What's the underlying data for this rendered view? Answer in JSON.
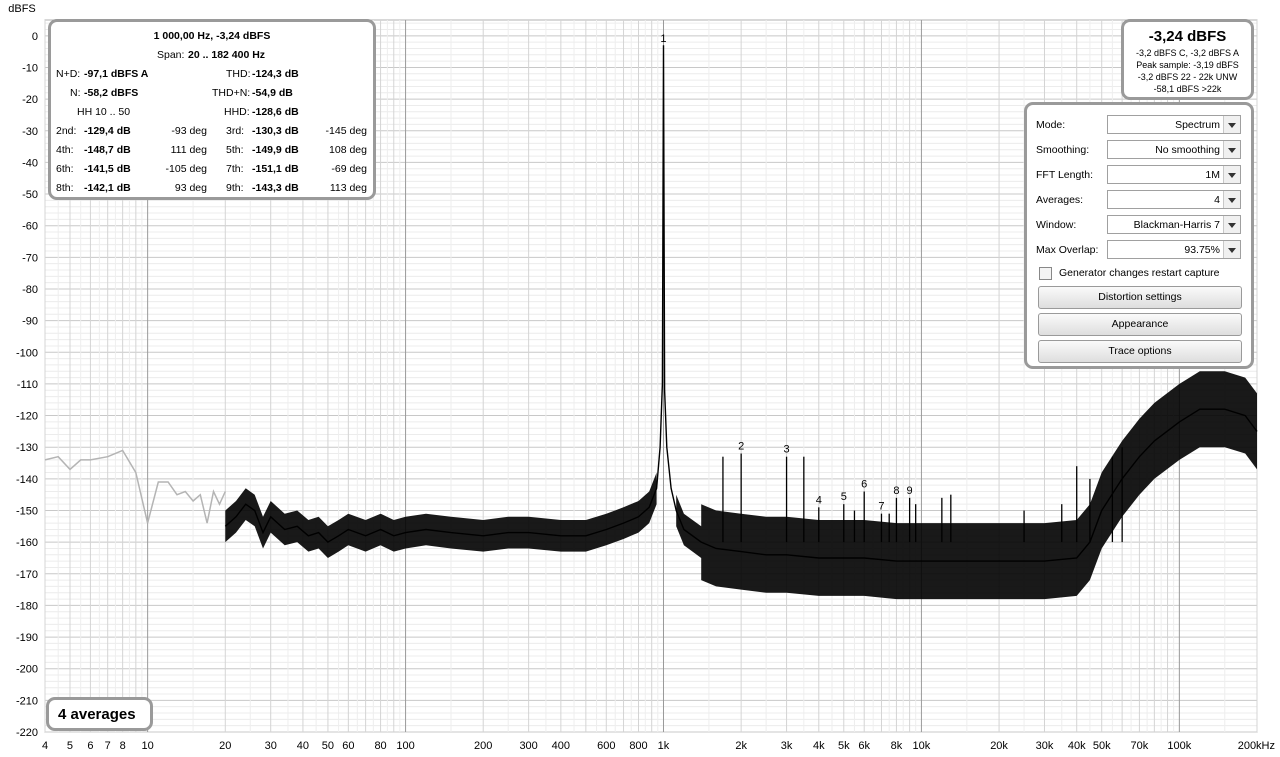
{
  "chart_data": {
    "type": "line",
    "ylabel": "dBFS",
    "xscale": "log",
    "xlim": [
      4,
      200000
    ],
    "ylim": [
      -220,
      5
    ],
    "y_ticks": [
      "0",
      "-10",
      "-20",
      "-30",
      "-40",
      "-50",
      "-60",
      "-70",
      "-80",
      "-90",
      "-100",
      "-110",
      "-120",
      "-130",
      "-140",
      "-150",
      "-160",
      "-170",
      "-180",
      "-190",
      "-200",
      "-210",
      "-220"
    ],
    "x_tick_labels": [
      {
        "f": 4,
        "t": "4"
      },
      {
        "f": 5,
        "t": "5"
      },
      {
        "f": 6,
        "t": "6"
      },
      {
        "f": 7,
        "t": "7"
      },
      {
        "f": 8,
        "t": "8"
      },
      {
        "f": 10,
        "t": "10"
      },
      {
        "f": 20,
        "t": "20"
      },
      {
        "f": 30,
        "t": "30"
      },
      {
        "f": 40,
        "t": "40"
      },
      {
        "f": 50,
        "t": "50"
      },
      {
        "f": 60,
        "t": "60"
      },
      {
        "f": 80,
        "t": "80"
      },
      {
        "f": 100,
        "t": "100"
      },
      {
        "f": 200,
        "t": "200"
      },
      {
        "f": 300,
        "t": "300"
      },
      {
        "f": 400,
        "t": "400"
      },
      {
        "f": 600,
        "t": "600"
      },
      {
        "f": 800,
        "t": "800"
      },
      {
        "f": 1000,
        "t": "1k"
      },
      {
        "f": 2000,
        "t": "2k"
      },
      {
        "f": 3000,
        "t": "3k"
      },
      {
        "f": 4000,
        "t": "4k"
      },
      {
        "f": 5000,
        "t": "5k"
      },
      {
        "f": 6000,
        "t": "6k"
      },
      {
        "f": 8000,
        "t": "8k"
      },
      {
        "f": 10000,
        "t": "10k"
      },
      {
        "f": 20000,
        "t": "20k"
      },
      {
        "f": 30000,
        "t": "30k"
      },
      {
        "f": 40000,
        "t": "40k"
      },
      {
        "f": 50000,
        "t": "50k"
      },
      {
        "f": 70000,
        "t": "70k"
      },
      {
        "f": 100000,
        "t": "100k"
      },
      {
        "f": 200000,
        "t": "200kHz"
      }
    ],
    "series": [
      {
        "color": "#b4b4b4",
        "x": [
          4,
          4.5,
          5,
          5.5,
          6,
          7,
          8,
          9,
          10,
          11,
          12,
          13,
          14,
          15,
          16,
          17,
          18,
          19,
          20
        ],
        "y": [
          -134,
          -133,
          -137,
          -134,
          -134,
          -133,
          -131,
          -138,
          -154,
          -141,
          -141,
          -145,
          -144,
          -147,
          -145,
          -154,
          -144,
          -148,
          -144
        ]
      },
      {
        "color": "#000000",
        "x": [
          20,
          22,
          24,
          26,
          28,
          30,
          34,
          38,
          42,
          46,
          50,
          55,
          60,
          70,
          80,
          90,
          100,
          120,
          150,
          200,
          250,
          300,
          400,
          500,
          600,
          700,
          800,
          880,
          940,
          970,
          990,
          1000,
          1010,
          1030,
          1070,
          1120,
          1200,
          1400,
          1600,
          2000,
          2500,
          3000,
          4000,
          5000,
          6000,
          8000,
          10000,
          15000,
          20000,
          30000,
          40000,
          45000,
          50000,
          60000,
          70000,
          80000,
          100000,
          120000,
          150000,
          180000,
          200000
        ],
        "y": [
          -155,
          -152,
          -148,
          -150,
          -157,
          -152,
          -156,
          -155,
          -158,
          -157,
          -160,
          -158,
          -156,
          -158,
          -156,
          -158,
          -157,
          -156,
          -157,
          -158,
          -157,
          -157,
          -158,
          -158,
          -156,
          -154,
          -152,
          -149,
          -143,
          -130,
          -110,
          -3,
          -112,
          -130,
          -143,
          -150,
          -156,
          -160,
          -162,
          -163,
          -164,
          -164,
          -165,
          -165,
          -165,
          -166,
          -166,
          -166,
          -166,
          -166,
          -165,
          -160,
          -150,
          -140,
          -133,
          -128,
          -122,
          -118,
          -118,
          -120,
          -125
        ]
      }
    ],
    "harmonic_markers": [
      {
        "label": "1",
        "f": 1000,
        "db": -3.2
      },
      {
        "label": "2",
        "f": 2000,
        "db": -132
      },
      {
        "label": "3",
        "f": 3000,
        "db": -133
      },
      {
        "label": "4",
        "f": 4000,
        "db": -149
      },
      {
        "label": "5",
        "f": 5000,
        "db": -148
      },
      {
        "label": "6",
        "f": 6000,
        "db": -144
      },
      {
        "label": "7",
        "f": 7000,
        "db": -151
      },
      {
        "label": "8",
        "f": 8000,
        "db": -146
      },
      {
        "label": "9",
        "f": 9000,
        "db": -146
      }
    ],
    "spikes": [
      {
        "f": 1700,
        "db": -133
      },
      {
        "f": 3500,
        "db": -133
      },
      {
        "f": 5500,
        "db": -150
      },
      {
        "f": 7500,
        "db": -151
      },
      {
        "f": 9500,
        "db": -148
      },
      {
        "f": 12000,
        "db": -146
      },
      {
        "f": 13000,
        "db": -145
      },
      {
        "f": 25000,
        "db": -150
      },
      {
        "f": 35000,
        "db": -148
      },
      {
        "f": 40000,
        "db": -136
      },
      {
        "f": 45000,
        "db": -140
      },
      {
        "f": 55000,
        "db": -133
      },
      {
        "f": 60000,
        "db": -130
      }
    ]
  },
  "measurements": {
    "header": "1 000,00 Hz, -3,24 dBFS",
    "span_label": "Span:",
    "span_value": "20 .. 182 400 Hz",
    "nd_label": "N+D:",
    "nd_value": "-97,1 dBFS A",
    "thd_label": "THD:",
    "thd_value": "-124,3 dB",
    "n_label": "N:",
    "n_value": "-58,2 dBFS",
    "thdn_label": "THD+N:",
    "thdn_value": "-54,9 dB",
    "hh_label": "HH 10 .. 50",
    "hhd_label": "HHD:",
    "hhd_value": "-128,6 dB",
    "harmonics": [
      {
        "l": "2nd:",
        "v": "-129,4 dB",
        "p": "-93 deg",
        "l2": "3rd:",
        "v2": "-130,3 dB",
        "p2": "-145 deg"
      },
      {
        "l": "4th:",
        "v": "-148,7 dB",
        "p": "111 deg",
        "l2": "5th:",
        "v2": "-149,9 dB",
        "p2": "108 deg"
      },
      {
        "l": "6th:",
        "v": "-141,5 dB",
        "p": "-105 deg",
        "l2": "7th:",
        "v2": "-151,1 dB",
        "p2": "-69 deg"
      },
      {
        "l": "8th:",
        "v": "-142,1 dB",
        "p": "93 deg",
        "l2": "9th:",
        "v2": "-143,3 dB",
        "p2": "113 deg"
      }
    ]
  },
  "peak": {
    "level": "-3,24 dBFS",
    "line1": "-3,2 dBFS C, -3,2 dBFS A",
    "line2": "Peak sample: -3,19 dBFS",
    "line3": "-3,2 dBFS 22 - 22k UNW",
    "line4": "-58,1 dBFS >22k"
  },
  "controls": {
    "mode_label": "Mode:",
    "mode_value": "Spectrum",
    "smoothing_label": "Smoothing:",
    "smoothing_value": "No  smoothing",
    "fft_label": "FFT Length:",
    "fft_value": "1M",
    "averages_label": "Averages:",
    "averages_value": "4",
    "window_label": "Window:",
    "window_value": "Blackman-Harris 7",
    "overlap_label": "Max Overlap:",
    "overlap_value": "93.75%",
    "generator_label": "Generator changes restart capture",
    "distortion_button": "Distortion settings",
    "appearance_button": "Appearance",
    "trace_button": "Trace options"
  },
  "averages_badge": "4 averages"
}
